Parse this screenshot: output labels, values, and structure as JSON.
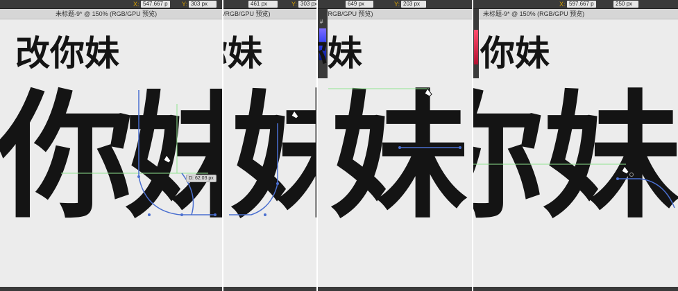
{
  "panels": [
    {
      "doc_title": "未标题-9* @ 150% (RGB/GPU 预览)",
      "x_value": "547.667 p",
      "y_value": "303 px"
    },
    {
      "doc_title": "/RGB/GPU 预览)",
      "x_value": "461 px",
      "y_value": "303 px"
    },
    {
      "doc_title": "/RGB/GPU 预览)",
      "x_value": "649 px",
      "y_value": "203 px"
    },
    {
      "doc_title": "未标题-9* @ 150% (RGB/GPU 预览)",
      "x_value": "597.667 p",
      "y_value": "250 px"
    }
  ],
  "labels": {
    "x": "X:",
    "y": "Y:"
  },
  "heading_text": "改你妹",
  "heading_text_short": "你妹",
  "large_glyph_ni": "你",
  "large_glyph_mei": "妹",
  "distance_tooltip": "D: 62.03 px",
  "swatch_label": "#",
  "colors": {
    "toolbar": "#3a3a3a",
    "canvas": "#ececec",
    "glyph": "#141414",
    "path": "#4a6fd0",
    "guide": "#8fe58f"
  }
}
